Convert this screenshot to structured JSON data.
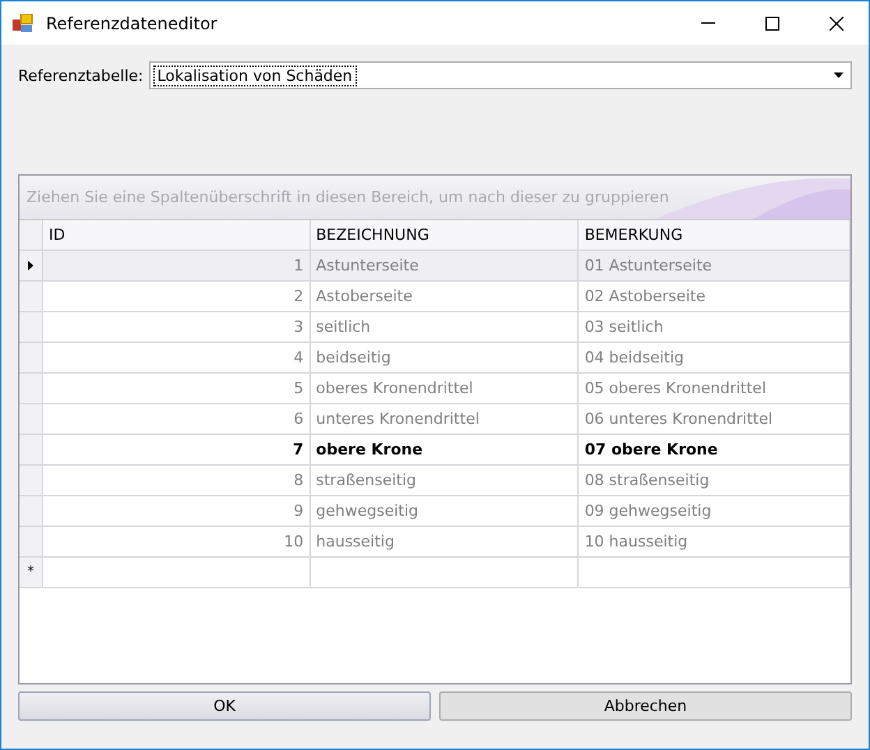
{
  "window": {
    "title": "Referenzdateneditor"
  },
  "table_selector": {
    "label": "Referenztabelle:",
    "value": "Lokalisation von Schäden"
  },
  "grid": {
    "group_hint": "Ziehen Sie eine Spaltenüberschrift in diesen Bereich, um nach dieser zu gruppieren",
    "columns": [
      "ID",
      "BEZEICHNUNG",
      "BEMERKUNG"
    ],
    "rows": [
      {
        "id": "1",
        "name": "Astunterseite",
        "remark": "01 Astunterseite",
        "selected": true,
        "highlighted": false
      },
      {
        "id": "2",
        "name": "Astoberseite",
        "remark": "02 Astoberseite",
        "selected": false,
        "highlighted": false
      },
      {
        "id": "3",
        "name": "seitlich",
        "remark": "03 seitlich",
        "selected": false,
        "highlighted": false
      },
      {
        "id": "4",
        "name": "beidseitig",
        "remark": "04 beidseitig",
        "selected": false,
        "highlighted": false
      },
      {
        "id": "5",
        "name": "oberes Kronendrittel",
        "remark": "05 oberes Kronendrittel",
        "selected": false,
        "highlighted": false
      },
      {
        "id": "6",
        "name": "unteres Kronendrittel",
        "remark": "06 unteres Kronendrittel",
        "selected": false,
        "highlighted": false
      },
      {
        "id": "7",
        "name": "obere Krone",
        "remark": "07 obere Krone",
        "selected": false,
        "highlighted": true
      },
      {
        "id": "8",
        "name": "straßenseitig",
        "remark": "08 straßenseitig",
        "selected": false,
        "highlighted": false
      },
      {
        "id": "9",
        "name": "gehwegseitig",
        "remark": "09 gehwegseitig",
        "selected": false,
        "highlighted": false
      },
      {
        "id": "10",
        "name": "hausseitig",
        "remark": "10 hausseitig",
        "selected": false,
        "highlighted": false
      }
    ],
    "new_row_marker": "*"
  },
  "buttons": [
    {
      "label": "OK",
      "kind": "default"
    },
    {
      "label": "Abbrechen",
      "kind": "normal"
    }
  ]
}
